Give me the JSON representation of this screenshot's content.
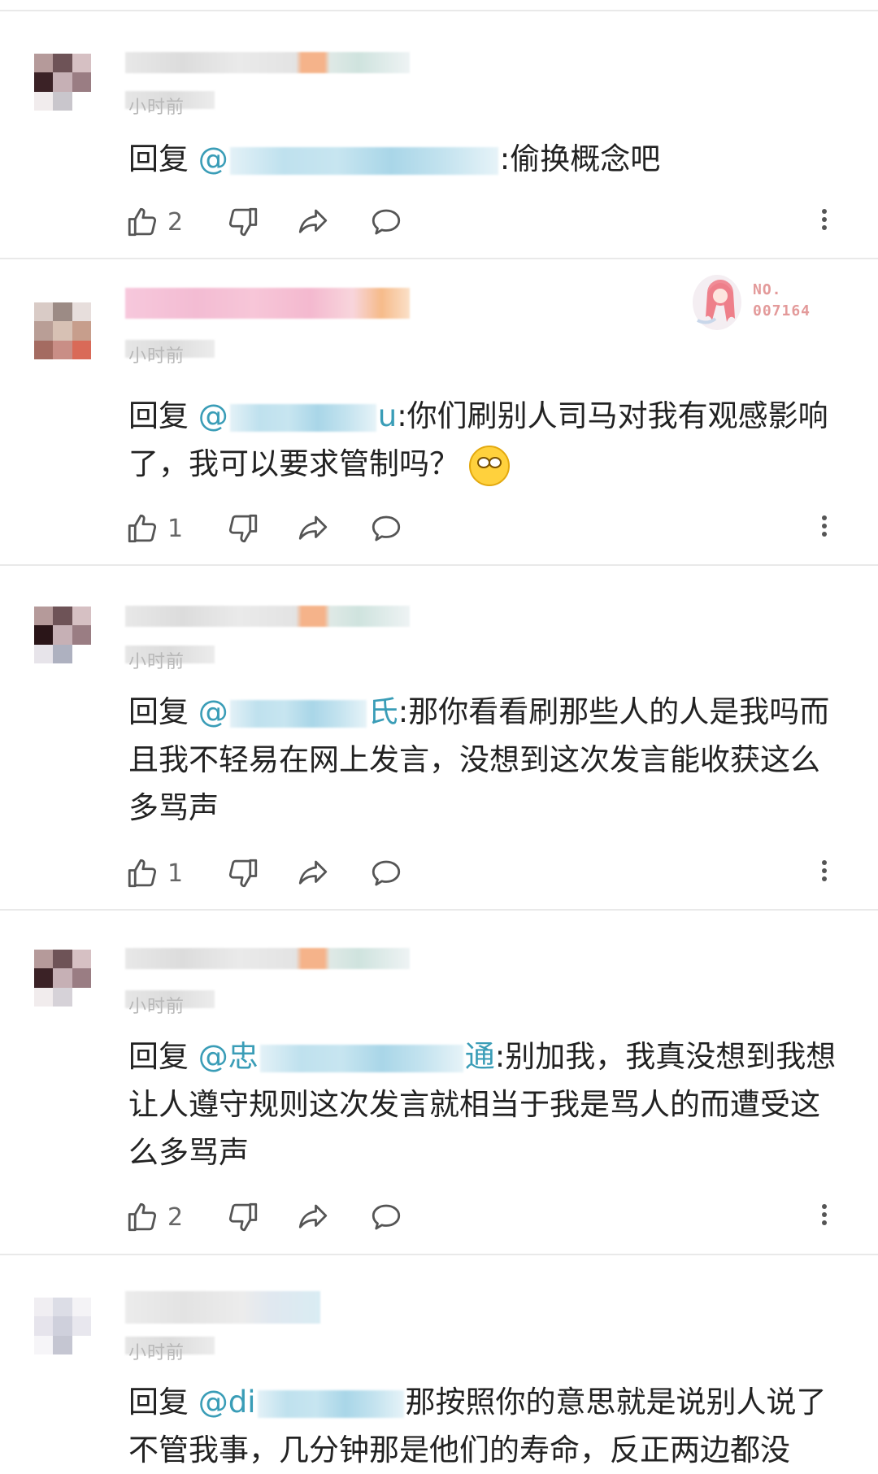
{
  "comments": [
    {
      "time": "小时前",
      "reply_label": "回复 ",
      "mention_prefix": "@",
      "mention_suffix": "",
      "text": ":偷换概念吧",
      "likes": "2"
    },
    {
      "time": "小时前",
      "reply_label": "回复 ",
      "mention_prefix": "@",
      "mention_suffix": "u",
      "text": ":你们刷别人司马对我有观感影响了，我可以要求管制吗？",
      "likes": "1",
      "badge": {
        "line1": "NO.",
        "line2": "007164"
      }
    },
    {
      "time": "小时前",
      "reply_label": "回复 ",
      "mention_prefix": "@",
      "mention_suffix": "氏",
      "text": ":那你看看刷那些人的人是我吗而且我不轻易在网上发言，没想到这次发言能收获这么多骂声",
      "likes": "1"
    },
    {
      "time": "小时前",
      "reply_label": "回复 ",
      "mention_prefix": "@忠",
      "mention_suffix": "通",
      "text": ":别加我，我真没想到我想让人遵守规则这次发言就相当于我是骂人的而遭受这么多骂声",
      "likes": "2"
    },
    {
      "time": "小时前",
      "reply_label": "回复 ",
      "mention_prefix": "@di",
      "mention_suffix": "",
      "text": "那按照你的意思就是说别人说了不管我事，几分钟那是他们的寿命，反正两边都没",
      "likes": ""
    }
  ],
  "icons": {
    "like": "thumb-up-icon",
    "dislike": "thumb-down-icon",
    "share": "share-arrow-icon",
    "reply": "speech-bubble-icon",
    "more": "more-vertical-icon"
  },
  "colors": {
    "mention": "#3a9db7",
    "text": "#222222",
    "icon": "#555555",
    "divider": "#e9e9e9"
  }
}
